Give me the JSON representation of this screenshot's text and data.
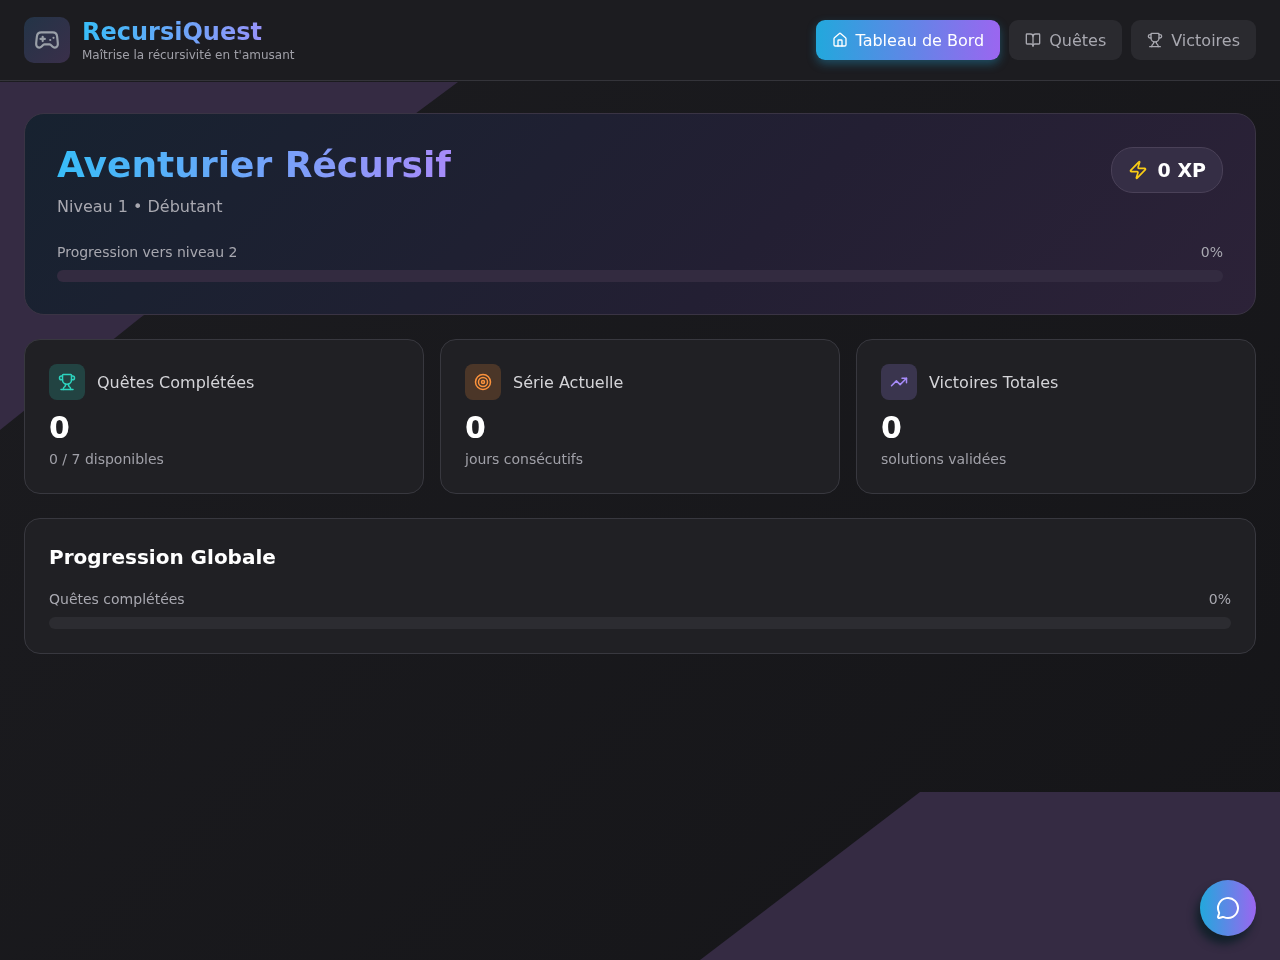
{
  "header": {
    "title": "RecursiQuest",
    "subtitle": "Maîtrise la récursivité en t'amusant"
  },
  "nav": [
    {
      "label": "Tableau de Bord",
      "kind": "home",
      "selected": true
    },
    {
      "label": "Quêtes",
      "kind": "book",
      "selected": false
    },
    {
      "label": "Victoires",
      "kind": "trophy",
      "selected": false
    }
  ],
  "hero": {
    "title": "Aventurier Récursif",
    "subtitle": "Niveau 1 • Débutant",
    "xp": "0 XP",
    "progress_label": "Progression vers niveau 2",
    "progress_reading": "0%",
    "level": 0
  },
  "stats": [
    {
      "kind": "trophy",
      "title": "Quêtes Complétées",
      "value": "0",
      "caption": "0 / 7 disponibles",
      "color": "#2dd4bf"
    },
    {
      "kind": "target",
      "title": "Série Actuelle",
      "value": "0",
      "caption": "jours consécutifs",
      "color": "#fb923c"
    },
    {
      "kind": "trend",
      "title": "Victoires Totales",
      "value": "0",
      "caption": "solutions validées",
      "color": "#a78bfa"
    }
  ],
  "global": {
    "title": "Progression Globale",
    "label": "Quêtes complétées",
    "reading": "0%",
    "level": 0
  }
}
